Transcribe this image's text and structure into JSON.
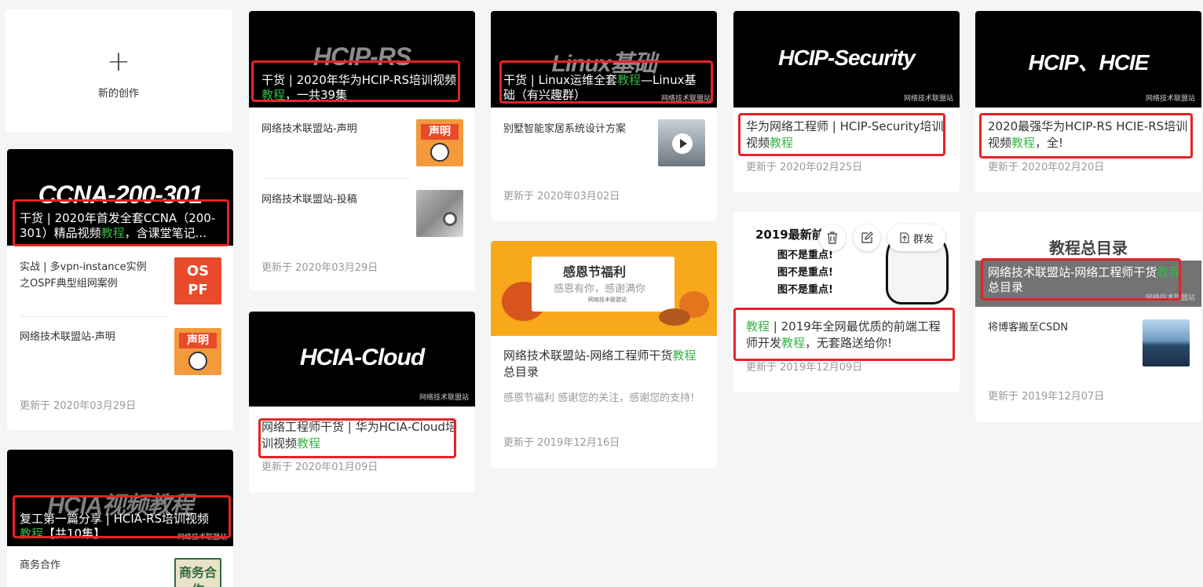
{
  "new_creation": {
    "icon": "+",
    "label": "新的创作"
  },
  "cards": {
    "ccna": {
      "cover": "CCNA-200-301",
      "title_pre": "干货 | 2020年首发全套CCNA（200-301）精品视频",
      "title_hl": "教程",
      "title_post": "，含课堂笔记...",
      "items": [
        {
          "text": "实战 | 多vpn-instance实例之OSPF典型组网案例",
          "thumb_text": "OS PF"
        },
        {
          "text": "网络技术联盟站-声明",
          "thumb_text": "声明"
        }
      ],
      "date": "更新于 2020年03月29日"
    },
    "hcia_rs": {
      "cover": "HCIA视频教程",
      "watermark": "网络技术联盟站",
      "title_pre": "复工第一篇分享 | HCIA-RS培训视频",
      "title_hl": "教程",
      "title_post": "【共10集】",
      "items": [
        {
          "text": "商务合作",
          "thumb_text": "商务合作"
        }
      ]
    },
    "hcip_rs": {
      "cover": "HCIP-RS",
      "title_pre": "干货 | 2020年华为HCIP-RS培训视频",
      "title_hl": "教程",
      "title_post": "，一共39集",
      "items": [
        {
          "text": "网络技术联盟站-声明",
          "thumb_text": "声明"
        },
        {
          "text": "网络技术联盟站-投稿"
        }
      ],
      "date": "更新于 2020年03月29日"
    },
    "hcia_cloud": {
      "cover": "HCIA-Cloud",
      "watermark": "网络技术联盟站",
      "title_pre": "网络工程师干货 | 华为HCIA-Cloud培训视频",
      "title_hl": "教程",
      "title_post": "",
      "date": "更新于 2020年01月09日"
    },
    "linux": {
      "cover": "Linux基础",
      "watermark": "网络技术联盟站",
      "title_pre": "干货 | Linux运维全套",
      "title_hl": "教程",
      "title_post": "—Linux基础（有兴趣群）",
      "items": [
        {
          "text": "别墅智能家居系统设计方案"
        }
      ],
      "date": "更新于 2020年03月02日"
    },
    "thanks": {
      "banner_title": "感恩节福利",
      "banner_sub": "感恩有你，感谢满你",
      "banner_org": "网络技术联盟站",
      "title_pre": "网络技术联盟站-网络工程师干货",
      "title_hl": "教程",
      "title_post": "总目录",
      "desc": "感恩节福利 感谢您的关注，感谢您的支持!",
      "date": "更新于 2019年12月16日"
    },
    "hcip_sec": {
      "cover": "HCIP-Security",
      "watermark": "网络技术联盟站",
      "title_pre": "华为网络工程师 | HCIP-Security培训视频",
      "title_hl": "教程",
      "title_post": "",
      "date": "更新于 2020年02月25日"
    },
    "frontend": {
      "cover_lines": [
        "2019最新前",
        "图不是重点!",
        "图不是重点!",
        "图不是重点!"
      ],
      "actions": {
        "delete_icon": "trash-icon",
        "edit_icon": "edit-icon",
        "mass_send": "群发"
      },
      "title_hl1": "教程",
      "title_mid": " | 2019年全网最优质的前端工程师开发",
      "title_hl2": "教程",
      "title_post": "，无套路送给你!",
      "date": "更新于 2019年12月09日"
    },
    "hcie": {
      "cover": "HCIP、HCIE",
      "watermark": "网络技术联盟站",
      "title_pre": "2020最强华为HCIP-RS HCIE-RS培训视频",
      "title_hl": "教程",
      "title_post": "，全!",
      "date": "更新于 2020年02月20日"
    },
    "catalog": {
      "cover": "教程总目录",
      "watermark": "网络技术联盟站",
      "title_pre": "网络技术联盟站-网络工程师干货",
      "title_hl": "教程",
      "title_post": "总目录",
      "items": [
        {
          "text": "将博客搬至CSDN"
        }
      ],
      "date": "更新于 2019年12月07日"
    }
  },
  "colors": {
    "highlight": "#3bb54a",
    "redbox": "#e62227",
    "background": "#f4f5f5"
  }
}
